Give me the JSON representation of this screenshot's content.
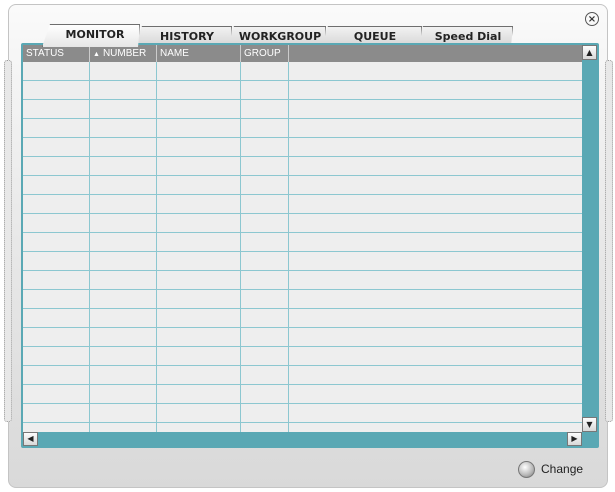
{
  "window": {
    "close_symbol": "×"
  },
  "tabs": [
    {
      "label": "MONITOR",
      "active": true
    },
    {
      "label": "HISTORY",
      "active": false
    },
    {
      "label": "WORKGROUP",
      "active": false
    },
    {
      "label": "QUEUE",
      "active": false
    },
    {
      "label": "Speed Dial",
      "active": false
    }
  ],
  "table": {
    "columns": [
      {
        "label": "STATUS"
      },
      {
        "label": "NUMBER",
        "sorted": "ascending"
      },
      {
        "label": "NAME"
      },
      {
        "label": "GROUP"
      },
      {
        "label": ""
      }
    ],
    "rows": []
  },
  "scrollbar": {
    "up_arrow": "▲",
    "down_arrow": "▼",
    "left_arrow": "◀",
    "right_arrow": "▶",
    "sort_arrow": "▲"
  },
  "footer": {
    "change_label": "Change"
  },
  "colors": {
    "grid_border": "#5aa8b4",
    "grid_lines": "#8cc7d0",
    "header_bg": "#8b8b8b"
  }
}
